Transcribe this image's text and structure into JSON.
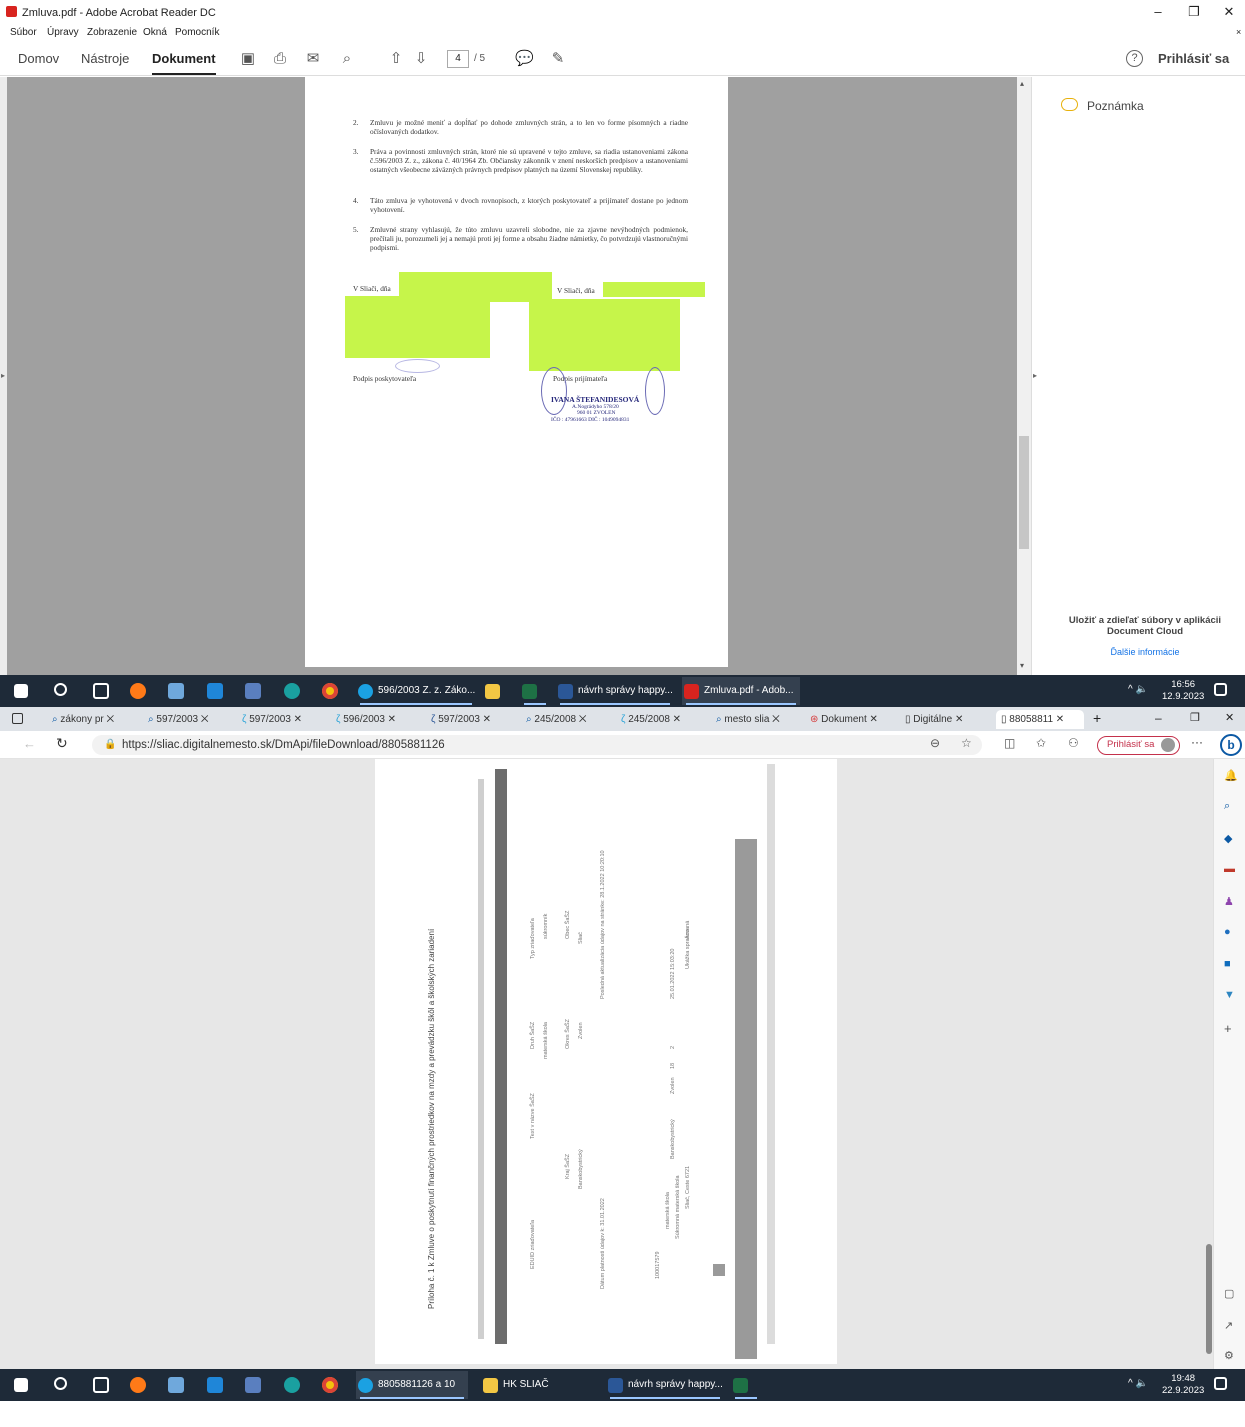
{
  "acrobat": {
    "title": "Zmluva.pdf - Adobe Acrobat Reader DC",
    "menu": [
      "Súbor",
      "Úpravy",
      "Zobrazenie",
      "Okná",
      "Pomocník"
    ],
    "tabs": {
      "home": "Domov",
      "tools": "Nástroje",
      "document": "Dokument"
    },
    "page_current": "4",
    "page_total": "/ 5",
    "sign_in": "Prihlásiť sa",
    "note_label": "Poznámka",
    "cloud_text": "Uložiť a zdieľať súbory v aplikácii Document Cloud",
    "more_info": "Ďalšie informácie",
    "doc": {
      "p2n": "2.",
      "p2": "Zmluvu je možné meniť a dopĺňať po dohode zmluvných strán, a to len vo forme písomných a riadne očíslovaných dodatkov.",
      "p3n": "3.",
      "p3": "Práva a povinnosti zmluvných strán, ktoré nie sú upravené v tejto zmluve, sa riadia ustanoveniami zákona č.596/2003 Z. z., zákona č. 40/1964 Zb. Občiansky zákonník v znení neskorších predpisov a ustanoveniami ostatných všeobecne záväzných právnych predpisov platných na území Slovenskej republiky.",
      "p4n": "4.",
      "p4": "Táto zmluva je vyhotovená v dvoch rovnopisoch, z ktorých poskytovateľ a prijímateľ dostane po jednom vyhotovení.",
      "p5n": "5.",
      "p5": "Zmluvné strany vyhlasujú, že túto zmluvu uzavreli slobodne, nie za zjavne nevýhodných podmienok, prečítali ju, porozumeli jej a nemajú proti jej forme a obsahu žiadne námietky, čo potvrdzujú vlastnoručnými podpismi.",
      "place_left": "V Sliači, dňa",
      "place_right": "V Sliači, dňa",
      "sign_left": "Podpis poskytovateľa",
      "sign_right": "Podpis prijímateľa",
      "stamp_name": "IVANA ŠTEFANIDESOVÁ",
      "stamp_addr": "A.Nográdyho 578/20",
      "stamp_city": "960 01 ZVOLEN",
      "stamp_ids": "IČO : 47961663   DIČ : 1049094831"
    }
  },
  "taskbar1": {
    "apps": [
      "596/2003 Z. z. Záko...",
      "",
      "návrh správy happy...",
      "Zmluva.pdf - Adob..."
    ],
    "time": "16:56",
    "date": "12.9.2023"
  },
  "edge": {
    "tabs": [
      "zákony pr",
      "597/2003",
      "597/2003",
      "596/2003",
      "597/2003",
      "245/2008",
      "245/2008",
      "mesto slia",
      "Dokument",
      "Digitálne",
      "88058811"
    ],
    "url": "https://sliac.digitalnemesto.sk/DmApi/fileDownload/8805881126",
    "sign_in": "Prihlásiť sa",
    "page_text": {
      "heading": "Príloha č. 1 k Zmluve o poskytnutí finančných prostriedkov na mzdy a prevádzku škôl a školských zariadení",
      "col1": "EDUID zriaďovateľa",
      "col2": "Text v názve ŠaŠZ",
      "col3": "Druh ŠaŠZ",
      "col4": "Typ zriaďovateľa",
      "col5": "Kraj ŠaŠZ",
      "col6": "Okres ŠaŠZ",
      "col7": "Obec ŠaŠZ",
      "val_type": "materská škola",
      "val_okres": "Zvolen",
      "val_obec": "Sliač",
      "val_kraj": "Banskobystrický",
      "val_zriad": "súkromník",
      "validity": "Dátum platnosti údajov k: 31.01.2022",
      "last_update": "Posledná aktualizácia údajov na stránke: 28.1.2022 10:20:10",
      "r_eduid": "100017579",
      "r_druh": "materská škola",
      "r_nazov": "Súkromná materská škola",
      "r_adresa": "Sliač, Ceste 6721",
      "r_kraj": "Banskobystrický",
      "r_okres": "Zvolen",
      "r_ziaci": "18",
      "r_zam": "2",
      "r_date": "25.01.2022 15:03:20",
      "r_stav": "Ukážka spracovaná",
      "r_chyby": "Áno"
    }
  },
  "taskbar2": {
    "apps": [
      "8805881126 a 10 ďa...",
      "HK SLIAČ",
      "návrh správy happy...",
      ""
    ],
    "time": "19:48",
    "date": "22.9.2023"
  },
  "colors": {
    "highlight": "#c6f54a",
    "taskbar": "#1e2a38",
    "acrobat_red": "#d8241f",
    "edge_blue": "#0c59a4"
  }
}
